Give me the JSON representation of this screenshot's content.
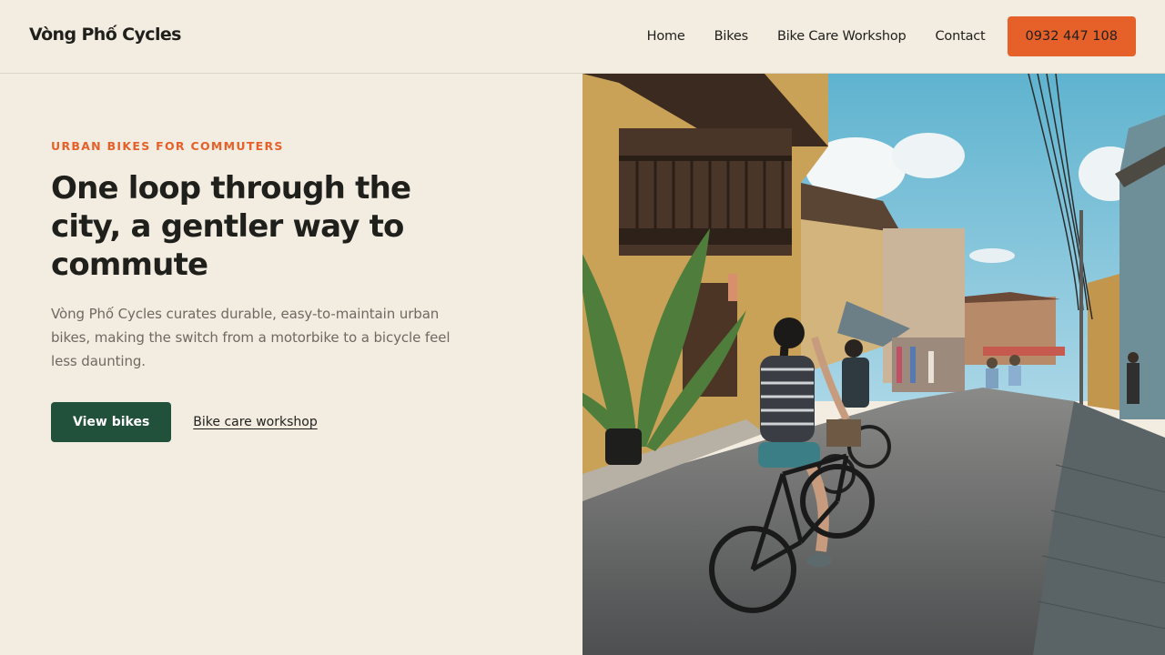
{
  "header": {
    "brand": "Vòng Phố Cycles",
    "nav": [
      {
        "label": "Home"
      },
      {
        "label": "Bikes"
      },
      {
        "label": "Bike Care Workshop"
      },
      {
        "label": "Contact"
      }
    ],
    "phone_button": "0932 447 108"
  },
  "hero": {
    "eyebrow": "URBAN BIKES FOR COMMUTERS",
    "headline": "One loop through the city, a gentler way to commute",
    "description": "Vòng Phố Cycles curates durable, easy-to-maintain urban bikes, making the switch from a motorbike to a bicycle feel less daunting.",
    "primary_cta": "View bikes",
    "secondary_cta": "Bike care workshop"
  },
  "colors": {
    "background": "#f3ece1",
    "accent": "#e6602a",
    "primary_button": "#21503b",
    "text": "#1f1f1c",
    "muted_text": "#6e6a62"
  }
}
